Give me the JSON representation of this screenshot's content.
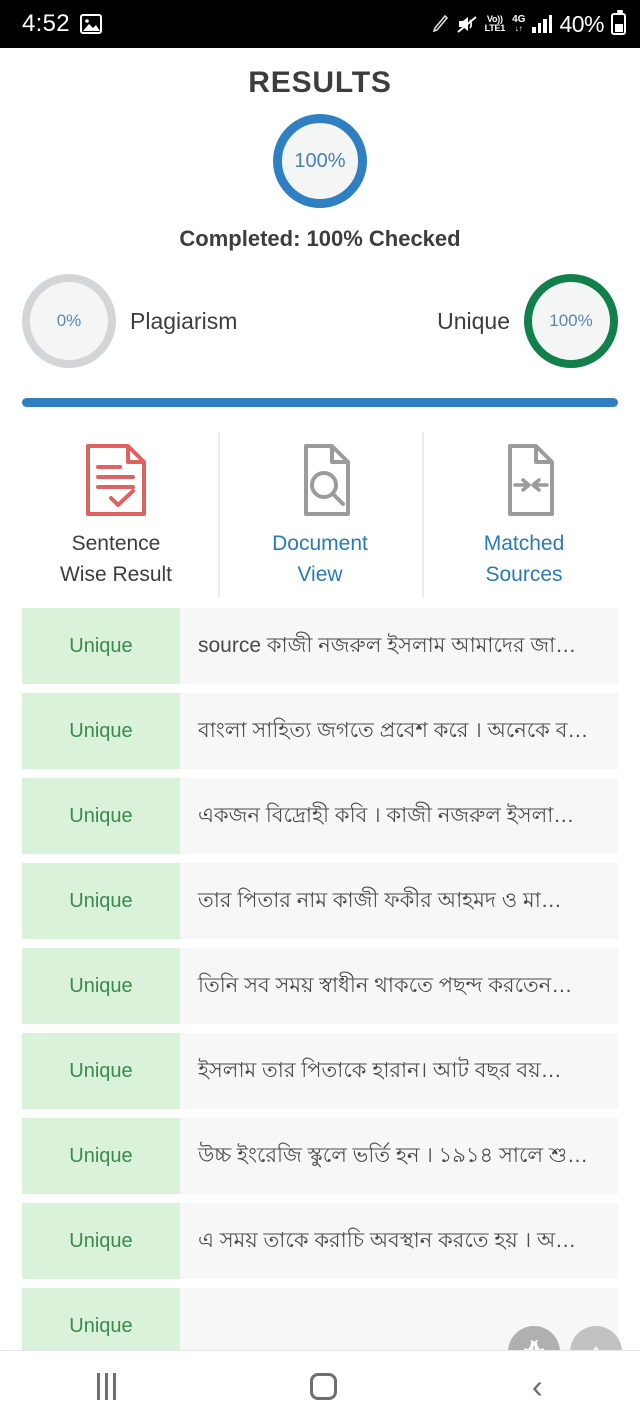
{
  "status_bar": {
    "time": "4:52",
    "gallery_icon": "image-icon",
    "pencil_icon": "pencil-icon",
    "mute_icon": "speaker-mute-icon",
    "volte_line1": "Vo))",
    "volte_line2": "LTE1",
    "network": "4G",
    "network_arrows": "↓↑",
    "signal_icon": "signal-bars-icon",
    "battery_percent": "40%",
    "battery_icon": "battery-icon"
  },
  "header": {
    "title": "RESULTS",
    "progress_value": "100%",
    "completed_text": "Completed: 100% Checked"
  },
  "scores": {
    "plagiarism": {
      "value": "0%",
      "label": "Plagiarism",
      "ring_color": "#d3d5d6"
    },
    "unique": {
      "value": "100%",
      "label": "Unique",
      "ring_color": "#12804a"
    }
  },
  "divider": {
    "color": "#2f80c2"
  },
  "tabs": [
    {
      "label_line1": "Sentence",
      "label_line2": "Wise Result",
      "icon": "document-checklist-icon",
      "active": true,
      "icon_color": "#e0625f"
    },
    {
      "label_line1": "Document",
      "label_line2": "View",
      "icon": "document-search-icon",
      "active": false,
      "icon_color": "#9b9b9b"
    },
    {
      "label_line1": "Matched",
      "label_line2": "Sources",
      "icon": "document-match-icon",
      "active": false,
      "icon_color": "#9b9b9b"
    }
  ],
  "results": {
    "badge_label": "Unique",
    "rows": [
      {
        "badge": "Unique",
        "text": "source কাজী নজরুল ইসলাম আমাদের জা…"
      },
      {
        "badge": "Unique",
        "text": "বাংলা সাহিত্য জগতে প্রবেশ করে । অনেকে ব…"
      },
      {
        "badge": "Unique",
        "text": "একজন বিদ্রোহী কবি । কাজী নজরুল ইসলা…"
      },
      {
        "badge": "Unique",
        "text": "তার পিতার নাম কাজী ফকীর আহমদ ও মা…"
      },
      {
        "badge": "Unique",
        "text": "তিনি সব সময় স্বাধীন থাকতে পছন্দ করতেন…"
      },
      {
        "badge": "Unique",
        "text": "ইসলাম তার পিতাকে হারান। আট বছর বয়…"
      },
      {
        "badge": "Unique",
        "text": "উচ্চ ইংরেজি স্কুলে ভর্তি হন । ১৯১৪ সালে শু…"
      },
      {
        "badge": "Unique",
        "text": "এ সময় তাকে করাচি অবস্থান করতে হয় । অ…"
      },
      {
        "badge": "Unique",
        "text": ""
      }
    ]
  },
  "fabs": [
    {
      "icon": "bug-icon",
      "name": "debug-fab"
    },
    {
      "icon": "arrow-up-icon",
      "glyph": "↑",
      "name": "scroll-top-fab"
    }
  ],
  "navbar": {
    "recents": "recents-icon",
    "home": "home-icon",
    "back": "back-icon",
    "back_glyph": "‹"
  }
}
